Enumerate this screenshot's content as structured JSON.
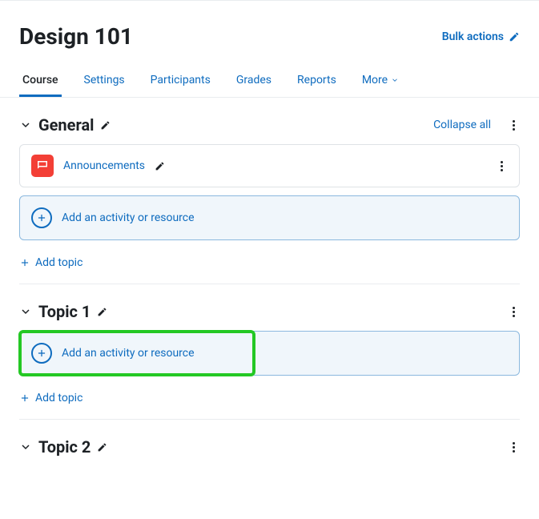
{
  "header": {
    "title": "Design 101",
    "bulk_actions": "Bulk actions"
  },
  "tabs": [
    {
      "label": "Course",
      "active": true
    },
    {
      "label": "Settings",
      "active": false
    },
    {
      "label": "Participants",
      "active": false
    },
    {
      "label": "Grades",
      "active": false
    },
    {
      "label": "Reports",
      "active": false
    },
    {
      "label": "More",
      "active": false
    }
  ],
  "collapse_all": "Collapse all",
  "add_activity": "Add an activity or resource",
  "add_topic": "Add topic",
  "sections": [
    {
      "title": "General",
      "activities": [
        {
          "name": "Announcements",
          "icon": "forum"
        }
      ]
    },
    {
      "title": "Topic 1",
      "activities": []
    },
    {
      "title": "Topic 2",
      "activities": []
    }
  ]
}
